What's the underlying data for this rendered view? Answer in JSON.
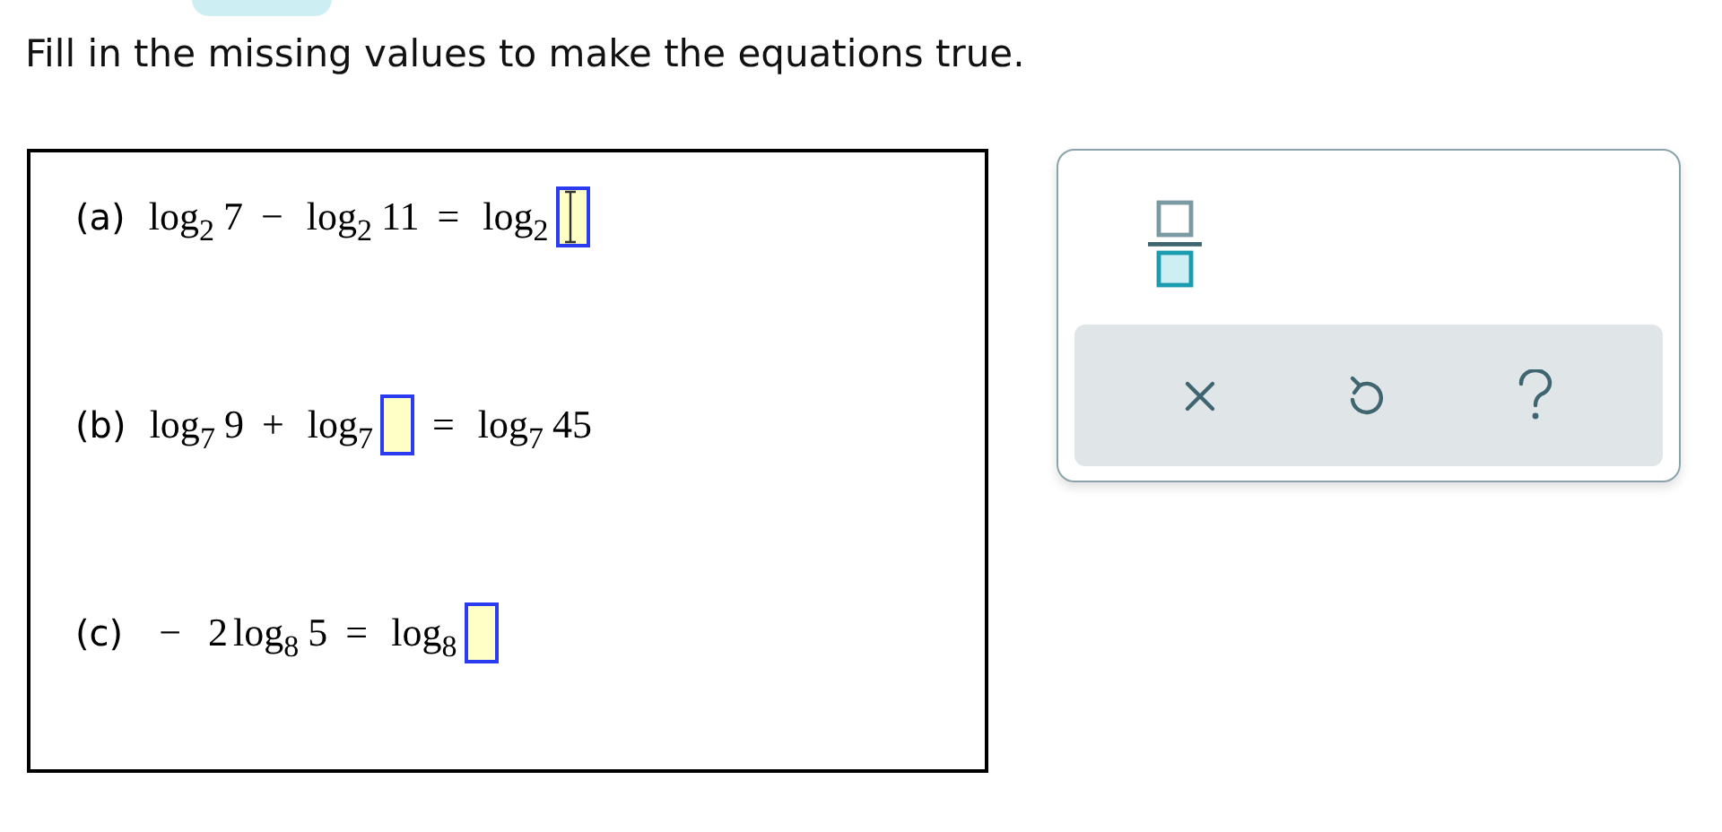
{
  "instruction": "Fill in the missing values to make the equations true.",
  "equations": [
    {
      "label": "(a)",
      "parts": [
        {
          "kind": "log",
          "name": "log",
          "base": "2"
        },
        {
          "kind": "num",
          "text": "7"
        },
        {
          "kind": "op",
          "text": "−"
        },
        {
          "kind": "log",
          "name": "log",
          "base": "2"
        },
        {
          "kind": "num",
          "text": "11"
        },
        {
          "kind": "op",
          "text": "="
        },
        {
          "kind": "log",
          "name": "log",
          "base": "2"
        },
        {
          "kind": "blank",
          "focused": true
        }
      ]
    },
    {
      "label": "(b)",
      "parts": [
        {
          "kind": "log",
          "name": "log",
          "base": "7"
        },
        {
          "kind": "num",
          "text": "9"
        },
        {
          "kind": "op",
          "text": "+"
        },
        {
          "kind": "log",
          "name": "log",
          "base": "7"
        },
        {
          "kind": "blank",
          "focused": false
        },
        {
          "kind": "op",
          "text": "="
        },
        {
          "kind": "log",
          "name": "log",
          "base": "7"
        },
        {
          "kind": "num",
          "text": "45"
        }
      ]
    },
    {
      "label": "(c)",
      "parts": [
        {
          "kind": "op",
          "text": "−"
        },
        {
          "kind": "num",
          "text": "2"
        },
        {
          "kind": "log",
          "name": "log",
          "base": "8"
        },
        {
          "kind": "num",
          "text": "5"
        },
        {
          "kind": "op",
          "text": "="
        },
        {
          "kind": "log",
          "name": "log",
          "base": "8"
        },
        {
          "kind": "blank",
          "focused": false
        }
      ]
    }
  ]
}
